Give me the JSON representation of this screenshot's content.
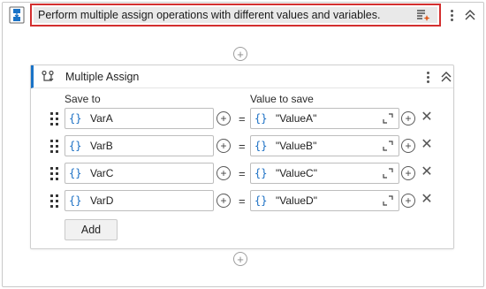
{
  "sequence": {
    "title": "Perform multiple assign operations with different values and variables.",
    "icon": "sequence-icon",
    "ai_icon": "autopilot-icon"
  },
  "activity": {
    "title": "Multiple Assign",
    "icon": "assign-icon",
    "save_to_label": "Save to",
    "value_label": "Value to save",
    "rows": [
      {
        "variable": "VarA",
        "value": "\"ValueA\""
      },
      {
        "variable": "VarB",
        "value": "\"ValueB\""
      },
      {
        "variable": "VarC",
        "value": "\"ValueC\""
      },
      {
        "variable": "VarD",
        "value": "\"ValueD\""
      }
    ],
    "equals": "=",
    "curly": "{}",
    "add_label": "Add"
  },
  "colors": {
    "highlight": "#d32f2f",
    "accent": "#1a73c7",
    "expression": "#1a6fc4"
  }
}
